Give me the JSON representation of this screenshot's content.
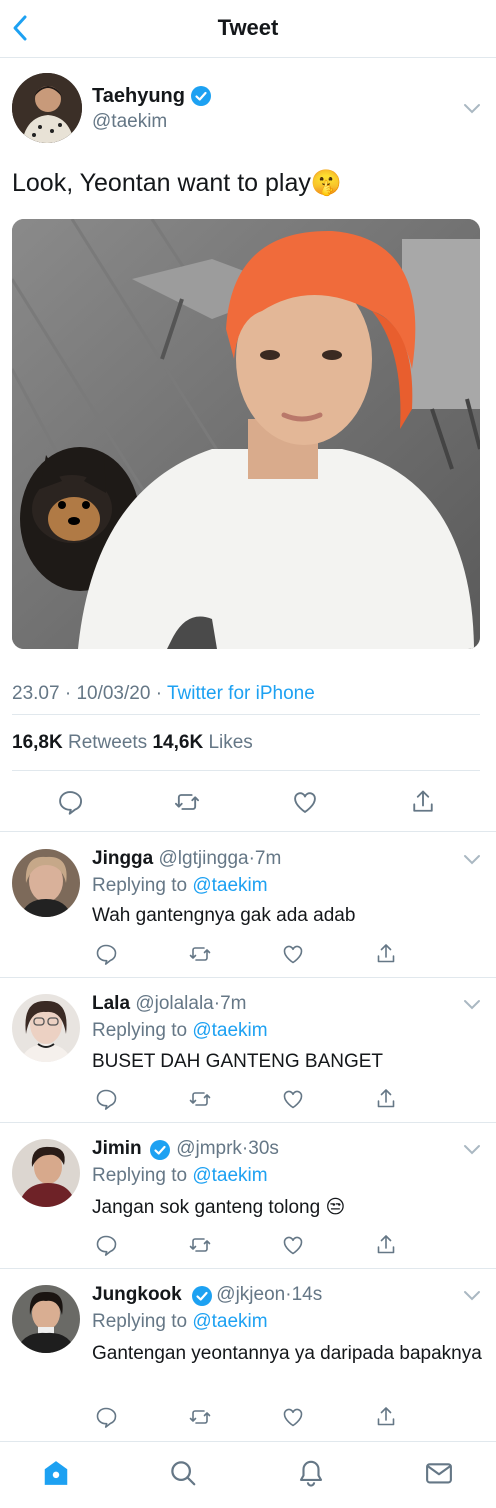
{
  "header": {
    "title": "Tweet"
  },
  "tweet": {
    "author_name": "Taehyung",
    "author_handle": "@taekim",
    "text": "Look, Yeontan want to play",
    "text_emoji": "🤫",
    "time": "23.07",
    "date": "10/03/20",
    "source": "Twitter for iPhone",
    "separator": "·",
    "retweets": "16,8K",
    "retweets_label": "Retweets",
    "likes": "14,6K",
    "likes_label": "Likes"
  },
  "replies": [
    {
      "name": "Jingga",
      "handle": "@lgtjingga",
      "time": "7m",
      "replying_prefix": "Replying to",
      "replying_to": "@taekim",
      "text": "Wah gantengnya gak ada adab",
      "verified": false
    },
    {
      "name": "Lala",
      "handle": "@jolalala",
      "time": "7m",
      "replying_prefix": "Replying to",
      "replying_to": "@taekim",
      "text": "BUSET DAH GANTENG BANGET",
      "verified": false
    },
    {
      "name": "Jimin",
      "handle": "@jmprk",
      "time": "30s",
      "replying_prefix": "Replying to",
      "replying_to": "@taekim",
      "text": "Jangan sok ganteng tolong",
      "emoji": "😒",
      "verified": true
    },
    {
      "name": "Jungkook",
      "handle": "@jkjeon",
      "time": "14s",
      "replying_prefix": "Replying to",
      "replying_to": "@taekim",
      "text": "Gantengan yeontannya ya daripada bapaknya",
      "verified": true
    }
  ],
  "nav": {
    "items": [
      "home-icon",
      "search-icon",
      "notifications-icon",
      "messages-icon"
    ]
  },
  "colors": {
    "accent": "#1da1f2",
    "secondary_text": "#657786",
    "divider": "#e1e8ed"
  }
}
